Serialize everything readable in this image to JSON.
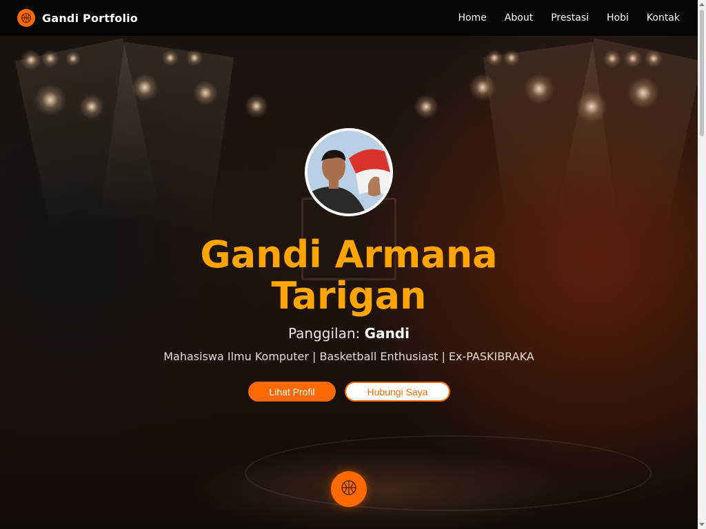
{
  "brand": {
    "name": "Gandi Portfolio",
    "icon": "basketball-icon"
  },
  "nav": {
    "items": [
      {
        "label": "Home"
      },
      {
        "label": "About"
      },
      {
        "label": "Prestasi"
      },
      {
        "label": "Hobi"
      },
      {
        "label": "Kontak"
      }
    ]
  },
  "hero": {
    "name": "Gandi Armana Tarigan",
    "nickname_label": "Panggilan:",
    "nickname": "Gandi",
    "tagline": "Mahasiswa Ilmu Komputer | Basketball Enthusiast | Ex-PASKIBRAKA",
    "primary_button": "Lihat Profil",
    "secondary_button": "Hubungi Saya",
    "avatar_icon": "profile-photo",
    "floating_icon": "basketball-icon"
  },
  "colors": {
    "accent": "#ff6a00",
    "title": "#ffa500",
    "navbar": "#050505"
  }
}
